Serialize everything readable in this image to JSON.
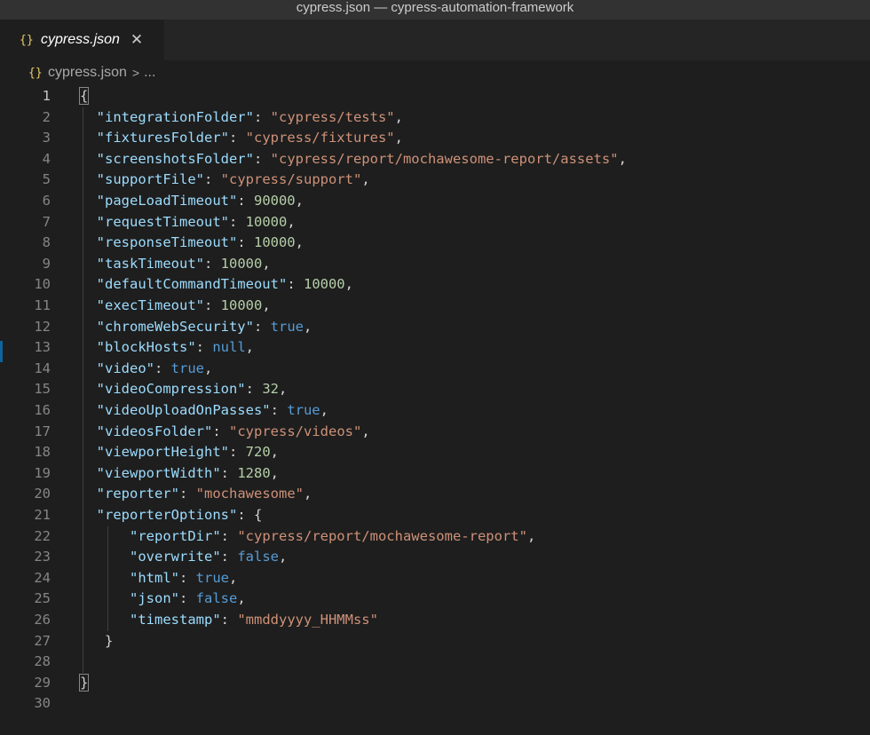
{
  "window": {
    "title": "cypress.json — cypress-automation-framework"
  },
  "tab": {
    "label": "cypress.json",
    "icon": "json-braces-icon",
    "icon_text": "{}",
    "close_text": "✕"
  },
  "breadcrumb": {
    "file": "cypress.json",
    "separator": ">",
    "more": "..."
  },
  "editor": {
    "line_numbers": [
      "1",
      "2",
      "3",
      "4",
      "5",
      "6",
      "7",
      "8",
      "9",
      "10",
      "11",
      "12",
      "13",
      "14",
      "15",
      "16",
      "17",
      "18",
      "19",
      "20",
      "21",
      "22",
      "23",
      "24",
      "25",
      "26",
      "27",
      "28",
      "29",
      "30"
    ],
    "lines": [
      [
        {
          "t": "p",
          "v": "{"
        }
      ],
      [
        {
          "t": "p",
          "v": "  "
        },
        {
          "t": "k",
          "v": "\"integrationFolder\""
        },
        {
          "t": "p",
          "v": ": "
        },
        {
          "t": "s",
          "v": "\"cypress/tests\""
        },
        {
          "t": "p",
          "v": ","
        }
      ],
      [
        {
          "t": "p",
          "v": "  "
        },
        {
          "t": "k",
          "v": "\"fixturesFolder\""
        },
        {
          "t": "p",
          "v": ": "
        },
        {
          "t": "s",
          "v": "\"cypress/fixtures\""
        },
        {
          "t": "p",
          "v": ","
        }
      ],
      [
        {
          "t": "p",
          "v": "  "
        },
        {
          "t": "k",
          "v": "\"screenshotsFolder\""
        },
        {
          "t": "p",
          "v": ": "
        },
        {
          "t": "s",
          "v": "\"cypress/report/mochawesome-report/assets\""
        },
        {
          "t": "p",
          "v": ","
        }
      ],
      [
        {
          "t": "p",
          "v": "  "
        },
        {
          "t": "k",
          "v": "\"supportFile\""
        },
        {
          "t": "p",
          "v": ": "
        },
        {
          "t": "s",
          "v": "\"cypress/support\""
        },
        {
          "t": "p",
          "v": ","
        }
      ],
      [
        {
          "t": "p",
          "v": "  "
        },
        {
          "t": "k",
          "v": "\"pageLoadTimeout\""
        },
        {
          "t": "p",
          "v": ": "
        },
        {
          "t": "n",
          "v": "90000"
        },
        {
          "t": "p",
          "v": ","
        }
      ],
      [
        {
          "t": "p",
          "v": "  "
        },
        {
          "t": "k",
          "v": "\"requestTimeout\""
        },
        {
          "t": "p",
          "v": ": "
        },
        {
          "t": "n",
          "v": "10000"
        },
        {
          "t": "p",
          "v": ","
        }
      ],
      [
        {
          "t": "p",
          "v": "  "
        },
        {
          "t": "k",
          "v": "\"responseTimeout\""
        },
        {
          "t": "p",
          "v": ": "
        },
        {
          "t": "n",
          "v": "10000"
        },
        {
          "t": "p",
          "v": ","
        }
      ],
      [
        {
          "t": "p",
          "v": "  "
        },
        {
          "t": "k",
          "v": "\"taskTimeout\""
        },
        {
          "t": "p",
          "v": ": "
        },
        {
          "t": "n",
          "v": "10000"
        },
        {
          "t": "p",
          "v": ","
        }
      ],
      [
        {
          "t": "p",
          "v": "  "
        },
        {
          "t": "k",
          "v": "\"defaultCommandTimeout\""
        },
        {
          "t": "p",
          "v": ": "
        },
        {
          "t": "n",
          "v": "10000"
        },
        {
          "t": "p",
          "v": ","
        }
      ],
      [
        {
          "t": "p",
          "v": "  "
        },
        {
          "t": "k",
          "v": "\"execTimeout\""
        },
        {
          "t": "p",
          "v": ": "
        },
        {
          "t": "n",
          "v": "10000"
        },
        {
          "t": "p",
          "v": ","
        }
      ],
      [
        {
          "t": "p",
          "v": "  "
        },
        {
          "t": "k",
          "v": "\"chromeWebSecurity\""
        },
        {
          "t": "p",
          "v": ": "
        },
        {
          "t": "b",
          "v": "true"
        },
        {
          "t": "p",
          "v": ","
        }
      ],
      [
        {
          "t": "p",
          "v": "  "
        },
        {
          "t": "k",
          "v": "\"blockHosts\""
        },
        {
          "t": "p",
          "v": ": "
        },
        {
          "t": "b",
          "v": "null"
        },
        {
          "t": "p",
          "v": ","
        }
      ],
      [
        {
          "t": "p",
          "v": "  "
        },
        {
          "t": "k",
          "v": "\"video\""
        },
        {
          "t": "p",
          "v": ": "
        },
        {
          "t": "b",
          "v": "true"
        },
        {
          "t": "p",
          "v": ","
        }
      ],
      [
        {
          "t": "p",
          "v": "  "
        },
        {
          "t": "k",
          "v": "\"videoCompression\""
        },
        {
          "t": "p",
          "v": ": "
        },
        {
          "t": "n",
          "v": "32"
        },
        {
          "t": "p",
          "v": ","
        }
      ],
      [
        {
          "t": "p",
          "v": "  "
        },
        {
          "t": "k",
          "v": "\"videoUploadOnPasses\""
        },
        {
          "t": "p",
          "v": ": "
        },
        {
          "t": "b",
          "v": "true"
        },
        {
          "t": "p",
          "v": ","
        }
      ],
      [
        {
          "t": "p",
          "v": "  "
        },
        {
          "t": "k",
          "v": "\"videosFolder\""
        },
        {
          "t": "p",
          "v": ": "
        },
        {
          "t": "s",
          "v": "\"cypress/videos\""
        },
        {
          "t": "p",
          "v": ","
        }
      ],
      [
        {
          "t": "p",
          "v": "  "
        },
        {
          "t": "k",
          "v": "\"viewportHeight\""
        },
        {
          "t": "p",
          "v": ": "
        },
        {
          "t": "n",
          "v": "720"
        },
        {
          "t": "p",
          "v": ","
        }
      ],
      [
        {
          "t": "p",
          "v": "  "
        },
        {
          "t": "k",
          "v": "\"viewportWidth\""
        },
        {
          "t": "p",
          "v": ": "
        },
        {
          "t": "n",
          "v": "1280"
        },
        {
          "t": "p",
          "v": ","
        }
      ],
      [
        {
          "t": "p",
          "v": "  "
        },
        {
          "t": "k",
          "v": "\"reporter\""
        },
        {
          "t": "p",
          "v": ": "
        },
        {
          "t": "s",
          "v": "\"mochawesome\""
        },
        {
          "t": "p",
          "v": ","
        }
      ],
      [
        {
          "t": "p",
          "v": "  "
        },
        {
          "t": "k",
          "v": "\"reporterOptions\""
        },
        {
          "t": "p",
          "v": ": {"
        }
      ],
      [
        {
          "t": "p",
          "v": "      "
        },
        {
          "t": "k",
          "v": "\"reportDir\""
        },
        {
          "t": "p",
          "v": ": "
        },
        {
          "t": "s",
          "v": "\"cypress/report/mochawesome-report\""
        },
        {
          "t": "p",
          "v": ","
        }
      ],
      [
        {
          "t": "p",
          "v": "      "
        },
        {
          "t": "k",
          "v": "\"overwrite\""
        },
        {
          "t": "p",
          "v": ": "
        },
        {
          "t": "b",
          "v": "false"
        },
        {
          "t": "p",
          "v": ","
        }
      ],
      [
        {
          "t": "p",
          "v": "      "
        },
        {
          "t": "k",
          "v": "\"html\""
        },
        {
          "t": "p",
          "v": ": "
        },
        {
          "t": "b",
          "v": "true"
        },
        {
          "t": "p",
          "v": ","
        }
      ],
      [
        {
          "t": "p",
          "v": "      "
        },
        {
          "t": "k",
          "v": "\"json\""
        },
        {
          "t": "p",
          "v": ": "
        },
        {
          "t": "b",
          "v": "false"
        },
        {
          "t": "p",
          "v": ","
        }
      ],
      [
        {
          "t": "p",
          "v": "      "
        },
        {
          "t": "k",
          "v": "\"timestamp\""
        },
        {
          "t": "p",
          "v": ": "
        },
        {
          "t": "s",
          "v": "\"mmddyyyy_HHMMss\""
        }
      ],
      [
        {
          "t": "p",
          "v": "   }"
        }
      ],
      [],
      [
        {
          "t": "p",
          "v": "}"
        }
      ],
      []
    ]
  },
  "colors": {
    "background": "#1e1e1e",
    "key": "#9cdcfe",
    "string": "#ce9178",
    "number": "#b5cea8",
    "keyword": "#569cd6",
    "punctuation": "#d4d4d4",
    "json_icon": "#e6cd69"
  }
}
